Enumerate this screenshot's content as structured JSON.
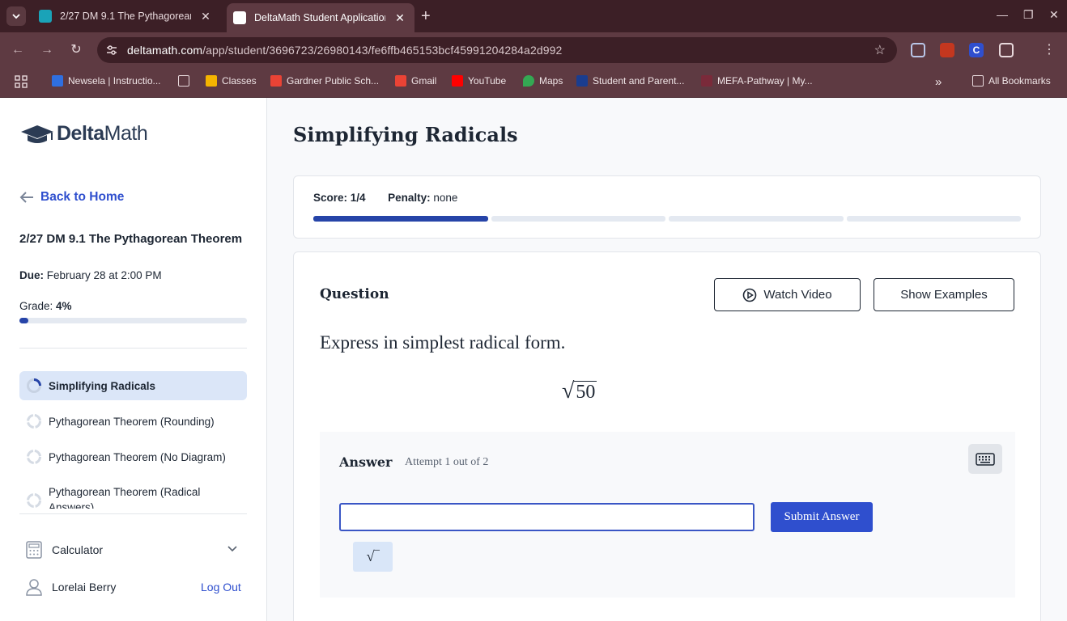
{
  "browser": {
    "tabs": [
      {
        "title": "2/27 DM 9.1 The Pythagorean",
        "active": false,
        "favicon_color": "#1aa3b8"
      },
      {
        "title": "DeltaMath Student Application",
        "active": true,
        "favicon_color": "#ffffff"
      }
    ],
    "new_tab_label": "+",
    "url_host": "deltamath.com",
    "url_path": "/app/student/3696723/26980143/fe6ffb465153bcf45991204284a2d992",
    "bookmarks": [
      {
        "label": "Newsela | Instructio...",
        "icon_color": "#2f6fe0"
      },
      {
        "label": "",
        "icon": "folder-icon"
      },
      {
        "label": "Classes",
        "icon_color": "#f4b400"
      },
      {
        "label": "Gardner Public Sch...",
        "icon": "gmail-icon"
      },
      {
        "label": "Gmail",
        "icon": "gmail-icon"
      },
      {
        "label": "YouTube",
        "icon_color": "#ff0000"
      },
      {
        "label": "Maps",
        "icon": "maps-icon"
      },
      {
        "label": "Student and Parent...",
        "icon_color": "#1a3d8f"
      },
      {
        "label": "MEFA-Pathway | My...",
        "icon_color": "#7a2a3a"
      }
    ],
    "all_bookmarks_label": "All Bookmarks"
  },
  "sidebar": {
    "logo_bold": "Delta",
    "logo_light": "Math",
    "back_label": "Back to Home",
    "assignment_title": "2/27 DM 9.1 The Pythagorean Theorem",
    "due_label": "Due:",
    "due_value": "February 28 at 2:00 PM",
    "grade_label": "Grade: ",
    "grade_value": "4%",
    "grade_fraction": 0.04,
    "skills": [
      {
        "label": "Simplifying Radicals",
        "active": true
      },
      {
        "label": "Pythagorean Theorem (Rounding)",
        "active": false
      },
      {
        "label": "Pythagorean Theorem (No Diagram)",
        "active": false
      },
      {
        "label": "Pythagorean Theorem (Radical Answers)",
        "active": false
      }
    ],
    "calculator_label": "Calculator",
    "user_name": "Lorelai Berry",
    "logout_label": "Log Out"
  },
  "main": {
    "title": "Simplifying Radicals",
    "score_label": "Score:",
    "score_value": "1/4",
    "penalty_label": "Penalty:",
    "penalty_value": "none",
    "score_segments_done": 1,
    "score_segments_total": 4,
    "question_label": "Question",
    "watch_video_label": "Watch Video",
    "show_examples_label": "Show Examples",
    "prompt": "Express in simplest radical form.",
    "radical_symbol": "√",
    "radicand": "50",
    "answer_label": "Answer",
    "attempt_text": "Attempt 1 out of 2",
    "answer_value": "",
    "submit_label": "Submit Answer",
    "sqrt_key_label": "√‾"
  },
  "colors": {
    "accent": "#2f4fce",
    "progress": "#2644a8",
    "chrome": "#5e3a42"
  }
}
